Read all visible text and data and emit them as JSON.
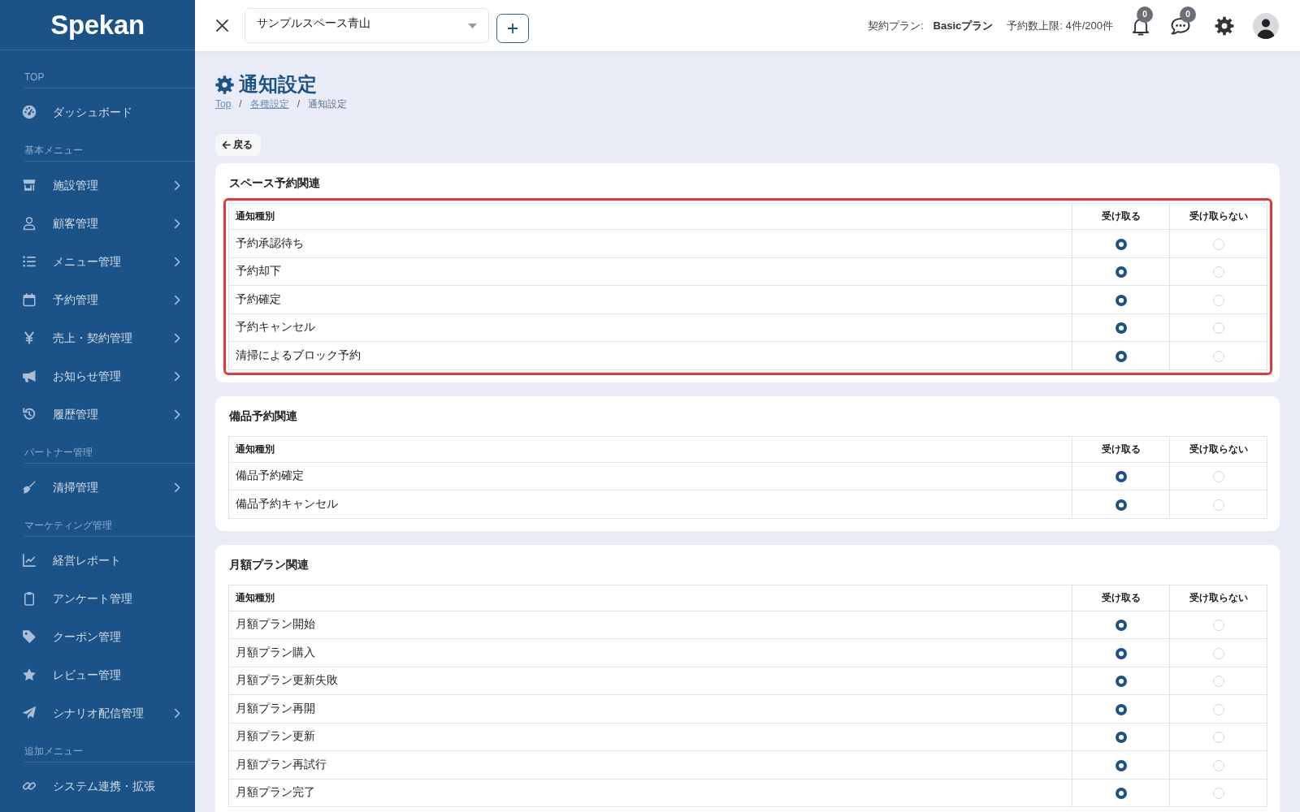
{
  "sidebar": {
    "logo": "Spekan",
    "sections": [
      {
        "label": "TOP",
        "items": [
          {
            "label": "ダッシュボード",
            "expandable": false
          }
        ]
      },
      {
        "label": "基本メニュー",
        "items": [
          {
            "label": "施設管理",
            "expandable": true
          },
          {
            "label": "顧客管理",
            "expandable": true
          },
          {
            "label": "メニュー管理",
            "expandable": true
          },
          {
            "label": "予約管理",
            "expandable": true
          },
          {
            "label": "売上・契約管理",
            "expandable": true
          },
          {
            "label": "お知らせ管理",
            "expandable": true
          },
          {
            "label": "履歴管理",
            "expandable": true
          }
        ]
      },
      {
        "label": "パートナー管理",
        "items": [
          {
            "label": "清掃管理",
            "expandable": true
          }
        ]
      },
      {
        "label": "マーケティング管理",
        "items": [
          {
            "label": "経営レポート",
            "expandable": false
          },
          {
            "label": "アンケート管理",
            "expandable": false
          },
          {
            "label": "クーポン管理",
            "expandable": false
          },
          {
            "label": "レビュー管理",
            "expandable": false
          },
          {
            "label": "シナリオ配信管理",
            "expandable": true
          }
        ]
      },
      {
        "label": "追加メニュー",
        "items": [
          {
            "label": "システム連携・拡張",
            "expandable": false
          }
        ]
      }
    ]
  },
  "top_bar": {
    "facility_select": {
      "value": "サンプルスペース青山"
    },
    "plan_label": "契約プラン:",
    "plan_name": "Basicプラン",
    "reservation_limit": "予約数上限: 4件/200件",
    "notification_count": "0",
    "message_count": "0"
  },
  "page": {
    "title": "通知設定",
    "breadcrumb": [
      {
        "kind": "link",
        "label": "Top"
      },
      {
        "kind": "separator",
        "label": "/"
      },
      {
        "kind": "link",
        "label": "各種設定"
      },
      {
        "kind": "separator",
        "label": "/"
      },
      {
        "kind": "current",
        "label": "通知設定"
      }
    ],
    "back_button": "戻る"
  },
  "sections": [
    {
      "title": "スペース予約関連",
      "highlighted": true,
      "columns": [
        "通知種別",
        "受け取る",
        "受け取らない"
      ],
      "rows": [
        {
          "label": "予約承認待ち",
          "receive": true
        },
        {
          "label": "予約却下",
          "receive": true
        },
        {
          "label": "予約確定",
          "receive": true
        },
        {
          "label": "予約キャンセル",
          "receive": true
        },
        {
          "label": "清掃によるブロック予約",
          "receive": true
        }
      ]
    },
    {
      "title": "備品予約関連",
      "highlighted": false,
      "columns": [
        "通知種別",
        "受け取る",
        "受け取らない"
      ],
      "rows": [
        {
          "label": "備品予約確定",
          "receive": true
        },
        {
          "label": "備品予約キャンセル",
          "receive": true
        }
      ]
    },
    {
      "title": "月額プラン関連",
      "highlighted": false,
      "columns": [
        "通知種別",
        "受け取る",
        "受け取らない"
      ],
      "rows": [
        {
          "label": "月額プラン開始",
          "receive": true
        },
        {
          "label": "月額プラン購入",
          "receive": true
        },
        {
          "label": "月額プラン更新失敗",
          "receive": true
        },
        {
          "label": "月額プラン再開",
          "receive": true
        },
        {
          "label": "月額プラン更新",
          "receive": true
        },
        {
          "label": "月額プラン再試行",
          "receive": true
        },
        {
          "label": "月額プラン完了",
          "receive": true
        }
      ]
    }
  ]
}
